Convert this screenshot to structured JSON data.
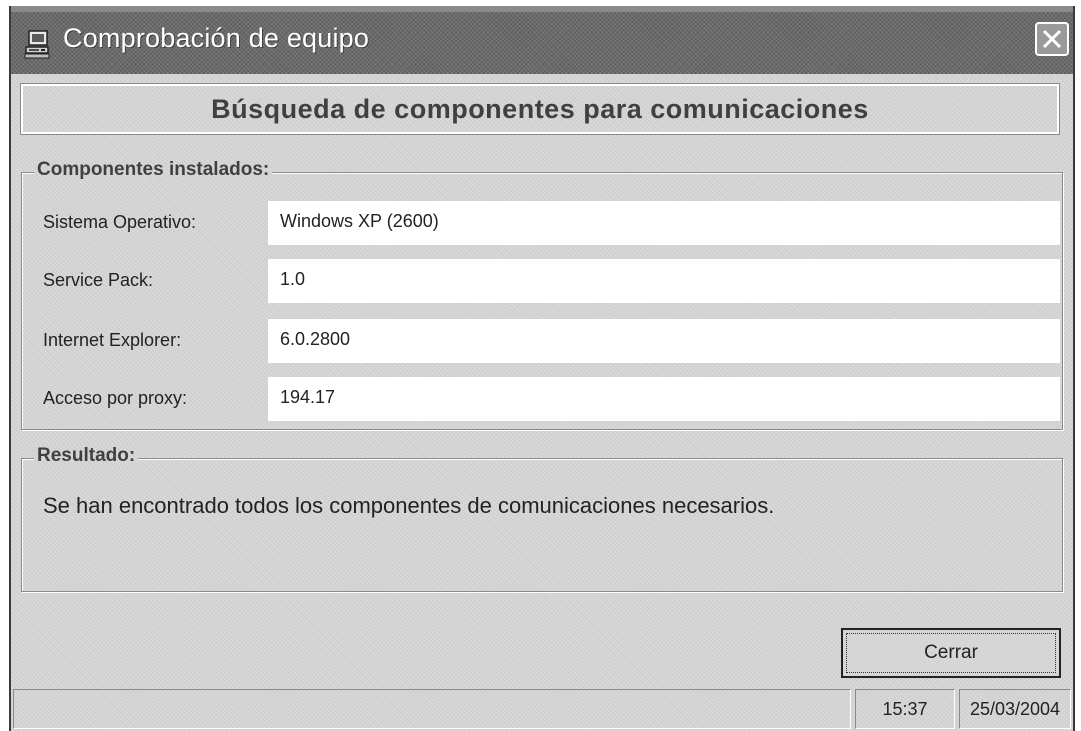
{
  "window": {
    "title": "Comprobación de equipo",
    "icon": "computer-check-icon",
    "close_icon": "close-icon"
  },
  "header": {
    "title": "Búsqueda de componentes para comunicaciones"
  },
  "components": {
    "legend": "Componentes instalados:",
    "fields": [
      {
        "label": "Sistema Operativo:",
        "value": "Windows XP (2600)"
      },
      {
        "label": "Service Pack:",
        "value": "1.0"
      },
      {
        "label": "Internet Explorer:",
        "value": "6.0.2800"
      },
      {
        "label": "Acceso por proxy:",
        "value": "194.17"
      }
    ]
  },
  "result": {
    "legend": "Resultado:",
    "message": "Se han encontrado todos los componentes de comunicaciones necesarios."
  },
  "buttons": {
    "close_label": "Cerrar"
  },
  "statusbar": {
    "main": "",
    "time": "15:37",
    "date": "25/03/2004"
  }
}
